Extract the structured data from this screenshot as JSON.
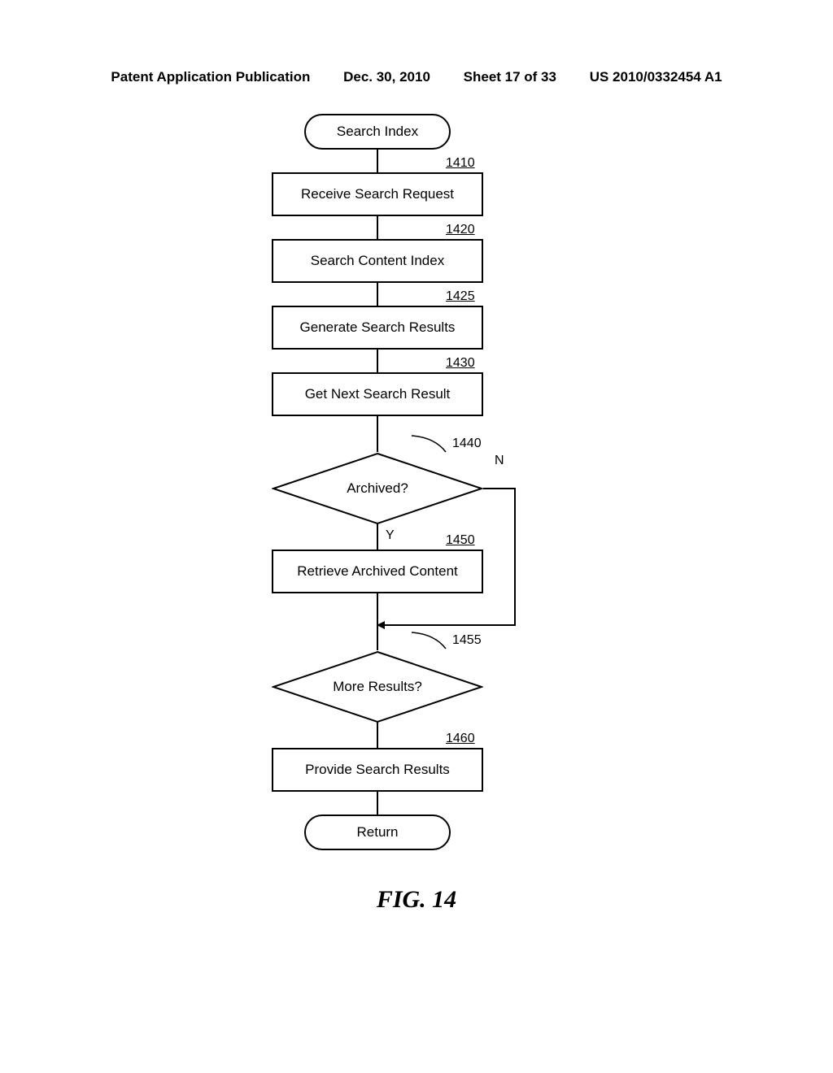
{
  "header": {
    "pub_type": "Patent Application Publication",
    "date": "Dec. 30, 2010",
    "sheet": "Sheet 17 of 33",
    "pub_no": "US 2010/0332454 A1"
  },
  "figure_label": "FIG. 14",
  "chart_data": {
    "type": "flowchart",
    "title": "FIG. 14",
    "nodes": [
      {
        "id": "start",
        "type": "terminator",
        "label": "Search Index"
      },
      {
        "id": "1410",
        "type": "process",
        "label": "Receive Search Request",
        "ref": "1410"
      },
      {
        "id": "1420",
        "type": "process",
        "label": "Search Content Index",
        "ref": "1420"
      },
      {
        "id": "1425",
        "type": "process",
        "label": "Generate Search Results",
        "ref": "1425"
      },
      {
        "id": "1430",
        "type": "process",
        "label": "Get Next Search Result",
        "ref": "1430"
      },
      {
        "id": "1440",
        "type": "decision",
        "label": "Archived?",
        "ref": "1440"
      },
      {
        "id": "1450",
        "type": "process",
        "label": "Retrieve Archived Content",
        "ref": "1450"
      },
      {
        "id": "1455",
        "type": "decision",
        "label": "More Results?",
        "ref": "1455"
      },
      {
        "id": "1460",
        "type": "process",
        "label": "Provide Search Results",
        "ref": "1460"
      },
      {
        "id": "end",
        "type": "terminator",
        "label": "Return"
      }
    ],
    "edges": [
      {
        "from": "start",
        "to": "1410"
      },
      {
        "from": "1410",
        "to": "1420"
      },
      {
        "from": "1420",
        "to": "1425"
      },
      {
        "from": "1425",
        "to": "1430"
      },
      {
        "from": "1430",
        "to": "1440"
      },
      {
        "from": "1440",
        "to": "1450",
        "label": "Y"
      },
      {
        "from": "1440",
        "to": "merge_after_1450",
        "label": "N"
      },
      {
        "from": "1450",
        "to": "merge_after_1450"
      },
      {
        "from": "merge_after_1450",
        "to": "1455"
      },
      {
        "from": "1455",
        "to": "1460"
      },
      {
        "from": "1460",
        "to": "end"
      }
    ]
  }
}
